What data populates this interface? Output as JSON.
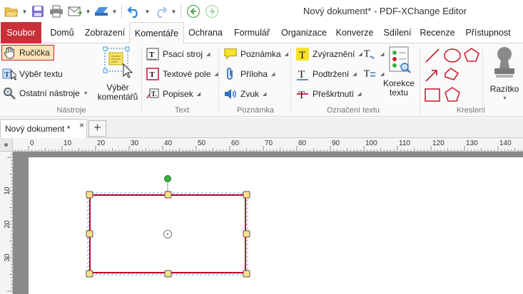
{
  "window": {
    "title": "Nový dokument* - PDF-XChange Editor"
  },
  "menu": {
    "file": "Soubor",
    "tabs": [
      "Domů",
      "Zobrazení",
      "Komentáře",
      "Ochrana",
      "Formulář",
      "Organizace",
      "Konverze",
      "Sdílení",
      "Recenze",
      "Přístupnost"
    ],
    "active_tab": "Komentáře"
  },
  "ribbon": {
    "tools": {
      "hand": "Ručička",
      "select_text": "Výběr textu",
      "other_tools": "Ostatní nástroje",
      "select_comments_l1": "Výběr",
      "select_comments_l2": "komentářů",
      "label": "Nástroje"
    },
    "text": {
      "typewriter": "Psací stroj",
      "text_box": "Textové pole",
      "callout": "Popisek",
      "label": "Text"
    },
    "note": {
      "sticky": "Poznámka",
      "attachment": "Příloha",
      "sound": "Zvuk",
      "label": "Poznámka"
    },
    "markup": {
      "highlight": "Zvýraznění",
      "underline": "Podtržení",
      "strikeout": "Přeškrtnutí",
      "proofread_l1": "Korekce",
      "proofread_l2": "textu",
      "label": "Označení textu"
    },
    "drawing": {
      "label": "Kreslení"
    },
    "stamp": {
      "label": "Razítko"
    }
  },
  "document": {
    "tab_label": "Nový dokument *",
    "close": "×",
    "new_tab": "+"
  },
  "rulers": {
    "h_labels": [
      "0",
      "10",
      "20",
      "30",
      "40",
      "50",
      "60",
      "70",
      "80",
      "90",
      "100",
      "110",
      "120",
      "130",
      "140"
    ],
    "v_labels": [
      "10",
      "20",
      "30"
    ]
  },
  "colors": {
    "file_tab": "#c8303a",
    "selection_red": "#d02030",
    "handle_fill": "#ffe08a",
    "rotate_handle": "#3cb043",
    "box_stroke": "#c00028",
    "hatch_blue": "#5b8fe0"
  }
}
